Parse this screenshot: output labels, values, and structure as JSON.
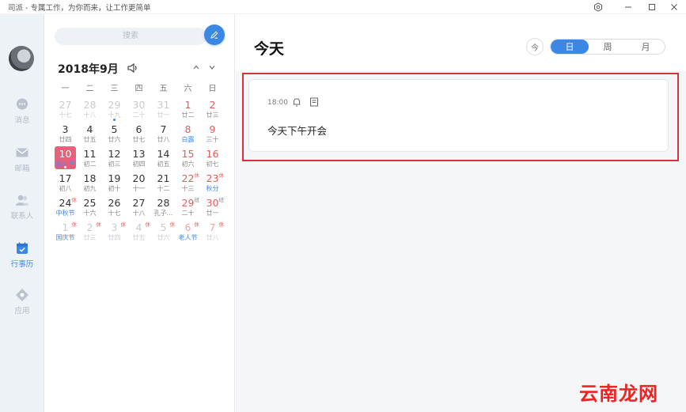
{
  "window": {
    "title": "司派 - 专属工作，为你而来，让工作更简单",
    "icons": [
      "settings-icon",
      "minimize-icon",
      "maximize-icon",
      "close-icon"
    ]
  },
  "nav": {
    "items": [
      {
        "key": "messages",
        "label": "消息",
        "icon": "chat-icon",
        "active": false
      },
      {
        "key": "mail",
        "label": "邮箱",
        "icon": "mail-icon",
        "active": false
      },
      {
        "key": "contacts",
        "label": "联系人",
        "icon": "contacts-icon",
        "active": false
      },
      {
        "key": "calendar",
        "label": "行事历",
        "icon": "calendar-icon",
        "active": true
      },
      {
        "key": "apps",
        "label": "应用",
        "icon": "apps-icon",
        "active": false
      }
    ]
  },
  "calendar": {
    "search_placeholder": "搜索",
    "month_label": "2018年9月",
    "weekdays": [
      "一",
      "二",
      "三",
      "四",
      "五",
      "六",
      "日"
    ],
    "days": [
      {
        "d": "27",
        "l": "十七",
        "other": true
      },
      {
        "d": "28",
        "l": "十八",
        "other": true
      },
      {
        "d": "29",
        "l": "十九",
        "other": true,
        "dot": true
      },
      {
        "d": "30",
        "l": "二十",
        "other": true
      },
      {
        "d": "31",
        "l": "廿一",
        "other": true
      },
      {
        "d": "1",
        "l": "廿二",
        "wkend": true
      },
      {
        "d": "2",
        "l": "廿三",
        "wkend": true
      },
      {
        "d": "3",
        "l": "廿四"
      },
      {
        "d": "4",
        "l": "廿五"
      },
      {
        "d": "5",
        "l": "廿六"
      },
      {
        "d": "6",
        "l": "廿七"
      },
      {
        "d": "7",
        "l": "廿八"
      },
      {
        "d": "8",
        "l": "白露",
        "wkend": true,
        "fest": true
      },
      {
        "d": "9",
        "l": "三十",
        "wkend": true
      },
      {
        "d": "10",
        "l": "教师节",
        "today": true
      },
      {
        "d": "11",
        "l": "初二"
      },
      {
        "d": "12",
        "l": "初三"
      },
      {
        "d": "13",
        "l": "初四"
      },
      {
        "d": "14",
        "l": "初五"
      },
      {
        "d": "15",
        "l": "初六",
        "wkend": true
      },
      {
        "d": "16",
        "l": "初七",
        "wkend": true
      },
      {
        "d": "17",
        "l": "初八"
      },
      {
        "d": "18",
        "l": "初九"
      },
      {
        "d": "19",
        "l": "初十"
      },
      {
        "d": "20",
        "l": "十一"
      },
      {
        "d": "21",
        "l": "十二"
      },
      {
        "d": "22",
        "l": "十三",
        "wkend": true,
        "badge": "休"
      },
      {
        "d": "23",
        "l": "秋分",
        "wkend": true,
        "fest": true,
        "badge": "休"
      },
      {
        "d": "24",
        "l": "中秋节",
        "fest": true,
        "badge": "休"
      },
      {
        "d": "25",
        "l": "十六"
      },
      {
        "d": "26",
        "l": "十七"
      },
      {
        "d": "27",
        "l": "十八"
      },
      {
        "d": "28",
        "l": "孔子..."
      },
      {
        "d": "29",
        "l": "二十",
        "wkend": true,
        "badge": "班",
        "work": true
      },
      {
        "d": "30",
        "l": "廿一",
        "wkend": true,
        "badge": "班",
        "work": true
      },
      {
        "d": "1",
        "l": "国庆节",
        "other": true,
        "fest": true,
        "badge": "休"
      },
      {
        "d": "2",
        "l": "廿三",
        "other": true,
        "badge": "休"
      },
      {
        "d": "3",
        "l": "廿四",
        "other": true,
        "badge": "休"
      },
      {
        "d": "4",
        "l": "廿五",
        "other": true,
        "badge": "休"
      },
      {
        "d": "5",
        "l": "廿六",
        "other": true,
        "badge": "休"
      },
      {
        "d": "6",
        "l": "老人节",
        "other": true,
        "wkend": true,
        "fest": true,
        "badge": "休"
      },
      {
        "d": "7",
        "l": "廿八",
        "other": true,
        "wkend": true,
        "badge": "休"
      }
    ]
  },
  "main": {
    "title": "今天",
    "today_button": "今",
    "views": [
      {
        "label": "日",
        "selected": true
      },
      {
        "label": "周",
        "selected": false
      },
      {
        "label": "月",
        "selected": false
      }
    ],
    "event": {
      "time": "18:00",
      "title": "今天下午开会"
    }
  },
  "watermark": "云南龙网",
  "colors": {
    "accent": "#3b87e6",
    "today": "#e8607a",
    "weekend": "#e45b5b",
    "highlight": "#d6323c"
  }
}
